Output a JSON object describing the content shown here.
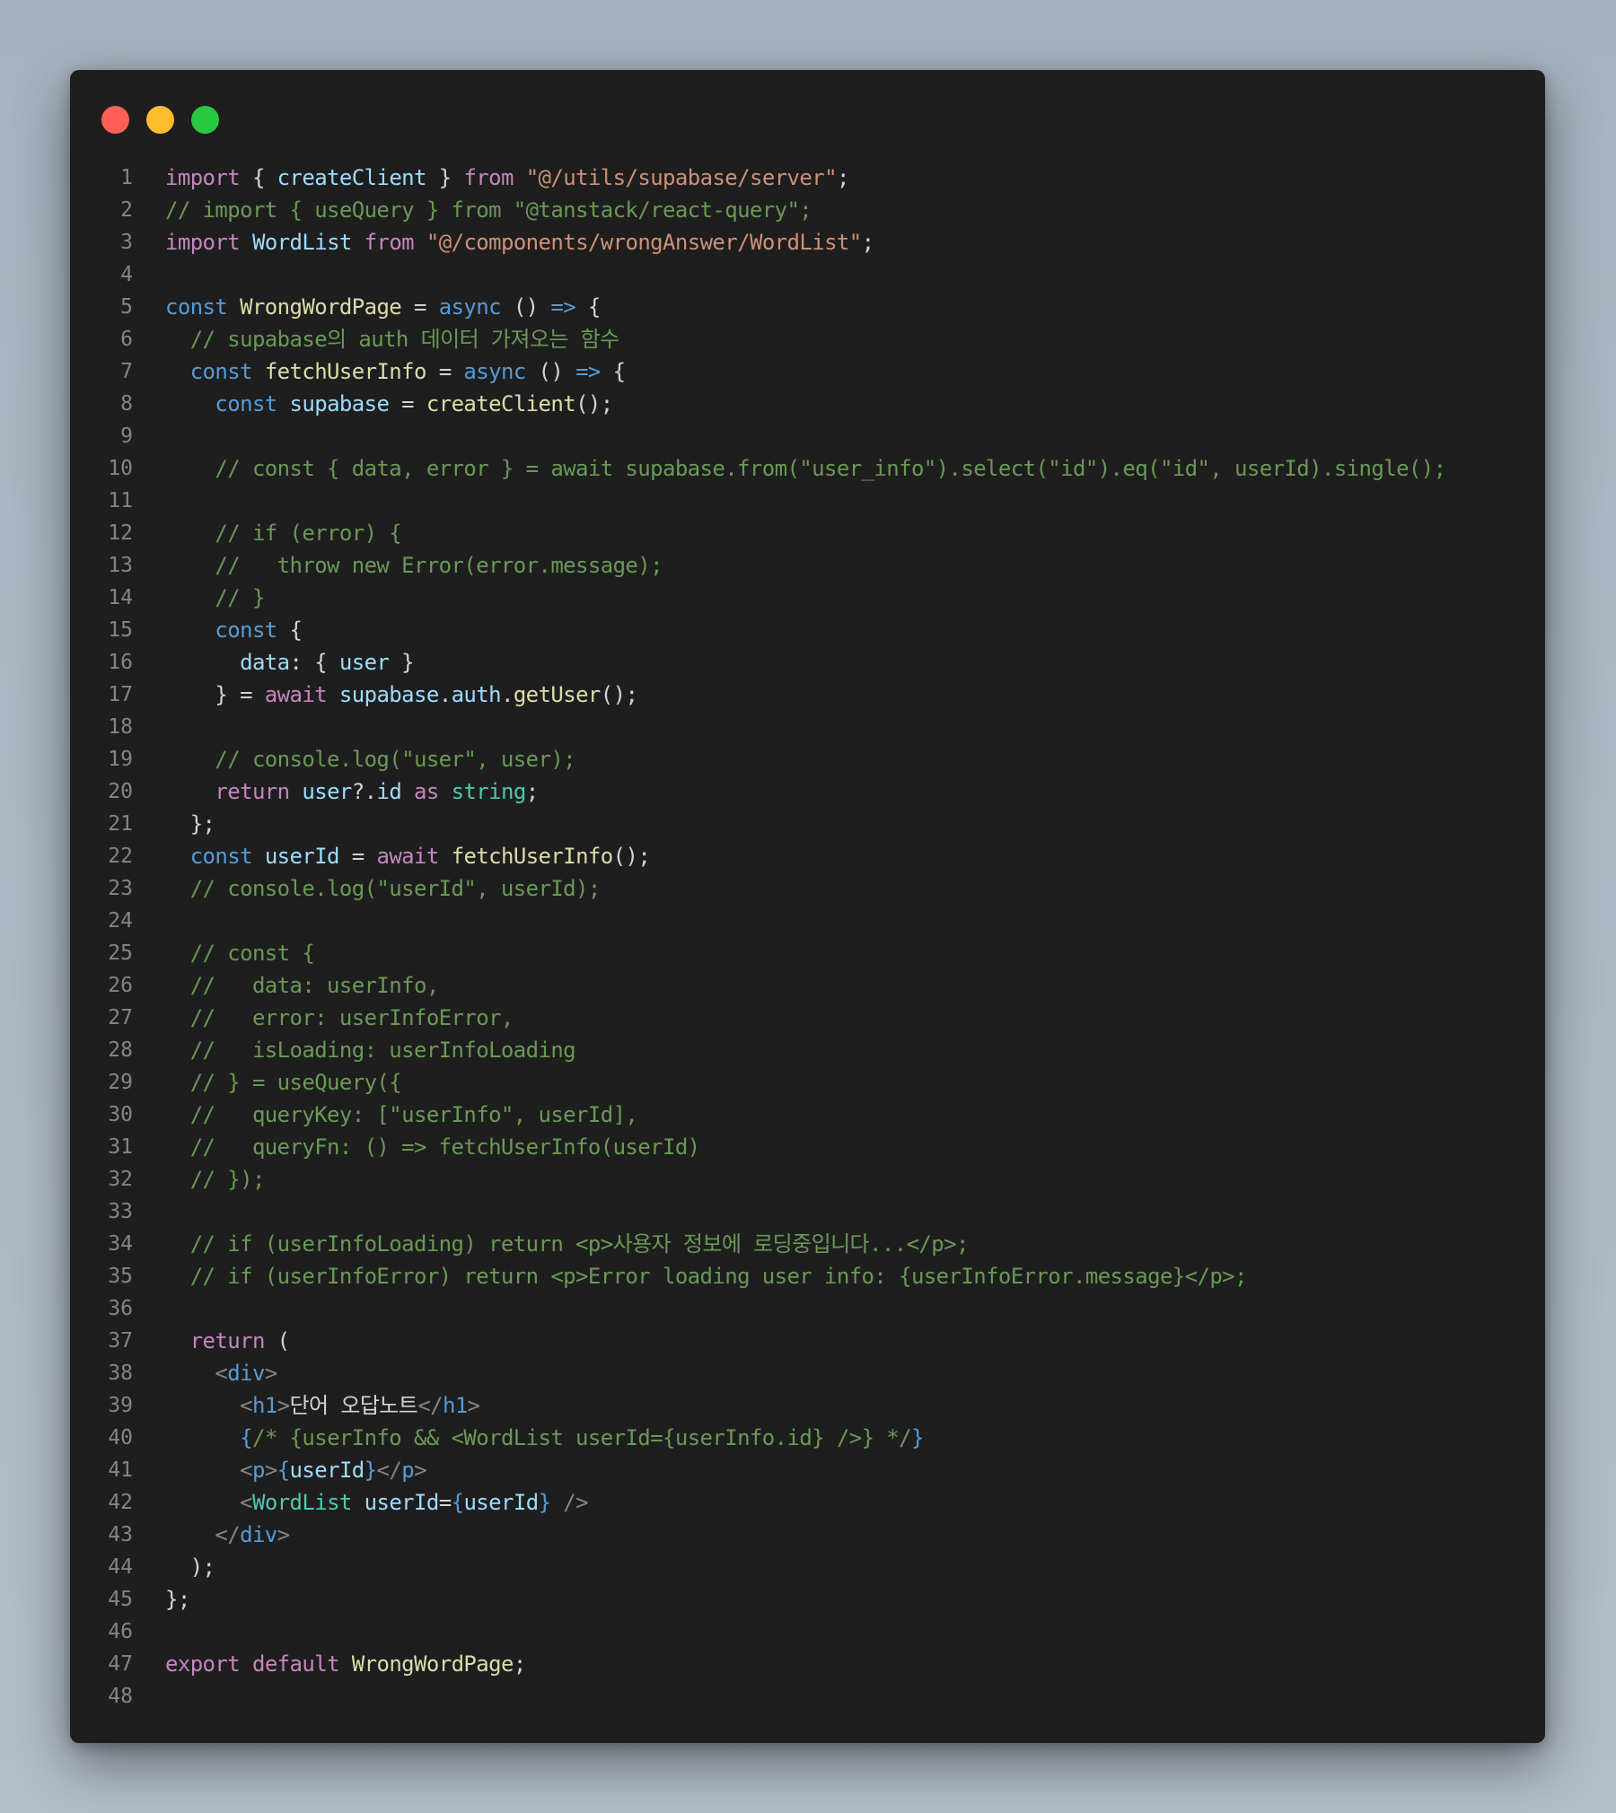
{
  "window": {
    "controls": [
      {
        "name": "close",
        "color": "#ff5f57"
      },
      {
        "name": "minimize",
        "color": "#febc2e"
      },
      {
        "name": "maximize",
        "color": "#28c840"
      }
    ]
  },
  "colors": {
    "background": "#1e1e1e",
    "line_number": "#858585",
    "keyword_purple": "#c586c0",
    "keyword_blue": "#569cd6",
    "string": "#ce9178",
    "comment": "#6a9955",
    "function": "#dcdcaa",
    "variable": "#9cdcfe",
    "type": "#4ec9b0",
    "default": "#d4d4d4"
  },
  "code": {
    "lines": [
      {
        "n": "1",
        "t": [
          [
            "import",
            "kw"
          ],
          [
            " { ",
            "pl"
          ],
          [
            "createClient",
            "vr"
          ],
          [
            " } ",
            "pl"
          ],
          [
            "from",
            "kw"
          ],
          [
            " ",
            "pl"
          ],
          [
            "\"@/utils/supabase/server\"",
            "st"
          ],
          [
            ";",
            "pl"
          ]
        ]
      },
      {
        "n": "2",
        "t": [
          [
            "// import { useQuery } from \"@tanstack/react-query\";",
            "cm"
          ]
        ]
      },
      {
        "n": "3",
        "t": [
          [
            "import",
            "kw"
          ],
          [
            " ",
            "pl"
          ],
          [
            "WordList",
            "vr"
          ],
          [
            " ",
            "pl"
          ],
          [
            "from",
            "kw"
          ],
          [
            " ",
            "pl"
          ],
          [
            "\"@/components/wrongAnswer/WordList\"",
            "st"
          ],
          [
            ";",
            "pl"
          ]
        ]
      },
      {
        "n": "4",
        "t": []
      },
      {
        "n": "5",
        "t": [
          [
            "const",
            "kb"
          ],
          [
            " ",
            "pl"
          ],
          [
            "WrongWordPage",
            "fn"
          ],
          [
            " = ",
            "pl"
          ],
          [
            "async",
            "kb"
          ],
          [
            " () ",
            "pl"
          ],
          [
            "=>",
            "kb"
          ],
          [
            " {",
            "pl"
          ]
        ]
      },
      {
        "n": "6",
        "t": [
          [
            "  // supabase의 auth 데이터 가져오는 함수",
            "cm"
          ]
        ]
      },
      {
        "n": "7",
        "t": [
          [
            "  ",
            "pl"
          ],
          [
            "const",
            "kb"
          ],
          [
            " ",
            "pl"
          ],
          [
            "fetchUserInfo",
            "fn"
          ],
          [
            " = ",
            "pl"
          ],
          [
            "async",
            "kb"
          ],
          [
            " () ",
            "pl"
          ],
          [
            "=>",
            "kb"
          ],
          [
            " {",
            "pl"
          ]
        ]
      },
      {
        "n": "8",
        "t": [
          [
            "    ",
            "pl"
          ],
          [
            "const",
            "kb"
          ],
          [
            " ",
            "pl"
          ],
          [
            "supabase",
            "vb"
          ],
          [
            " = ",
            "pl"
          ],
          [
            "createClient",
            "fn"
          ],
          [
            "();",
            "pl"
          ]
        ]
      },
      {
        "n": "9",
        "t": []
      },
      {
        "n": "10",
        "t": [
          [
            "    // const { data, error } = await supabase.from(\"user_info\").select(\"id\").eq(\"id\", userId).single();",
            "cm"
          ]
        ]
      },
      {
        "n": "11",
        "t": []
      },
      {
        "n": "12",
        "t": [
          [
            "    // if (error) {",
            "cm"
          ]
        ]
      },
      {
        "n": "13",
        "t": [
          [
            "    //   throw new Error(error.message);",
            "cm"
          ]
        ]
      },
      {
        "n": "14",
        "t": [
          [
            "    // }",
            "cm"
          ]
        ]
      },
      {
        "n": "15",
        "t": [
          [
            "    ",
            "pl"
          ],
          [
            "const",
            "kb"
          ],
          [
            " {",
            "pl"
          ]
        ]
      },
      {
        "n": "16",
        "t": [
          [
            "      ",
            "pl"
          ],
          [
            "data",
            "vr"
          ],
          [
            ": { ",
            "pl"
          ],
          [
            "user",
            "vb"
          ],
          [
            " }",
            "pl"
          ]
        ]
      },
      {
        "n": "17",
        "t": [
          [
            "    } = ",
            "pl"
          ],
          [
            "await",
            "kw"
          ],
          [
            " ",
            "pl"
          ],
          [
            "supabase",
            "vb"
          ],
          [
            ".",
            "pl"
          ],
          [
            "auth",
            "vr"
          ],
          [
            ".",
            "pl"
          ],
          [
            "getUser",
            "fn"
          ],
          [
            "();",
            "pl"
          ]
        ]
      },
      {
        "n": "18",
        "t": []
      },
      {
        "n": "19",
        "t": [
          [
            "    // console.log(\"user\", user);",
            "cm"
          ]
        ]
      },
      {
        "n": "20",
        "t": [
          [
            "    ",
            "pl"
          ],
          [
            "return",
            "kw"
          ],
          [
            " ",
            "pl"
          ],
          [
            "user",
            "vb"
          ],
          [
            "?.",
            "pl"
          ],
          [
            "id",
            "vr"
          ],
          [
            " ",
            "pl"
          ],
          [
            "as",
            "kw"
          ],
          [
            " ",
            "pl"
          ],
          [
            "string",
            "ty"
          ],
          [
            ";",
            "pl"
          ]
        ]
      },
      {
        "n": "21",
        "t": [
          [
            "  };",
            "pl"
          ]
        ]
      },
      {
        "n": "22",
        "t": [
          [
            "  ",
            "pl"
          ],
          [
            "const",
            "kb"
          ],
          [
            " ",
            "pl"
          ],
          [
            "userId",
            "vb"
          ],
          [
            " = ",
            "pl"
          ],
          [
            "await",
            "kw"
          ],
          [
            " ",
            "pl"
          ],
          [
            "fetchUserInfo",
            "fn"
          ],
          [
            "();",
            "pl"
          ]
        ]
      },
      {
        "n": "23",
        "t": [
          [
            "  // console.log(\"userId\", userId);",
            "cm"
          ]
        ]
      },
      {
        "n": "24",
        "t": []
      },
      {
        "n": "25",
        "t": [
          [
            "  // const {",
            "cm"
          ]
        ]
      },
      {
        "n": "26",
        "t": [
          [
            "  //   data: userInfo,",
            "cm"
          ]
        ]
      },
      {
        "n": "27",
        "t": [
          [
            "  //   error: userInfoError,",
            "cm"
          ]
        ]
      },
      {
        "n": "28",
        "t": [
          [
            "  //   isLoading: userInfoLoading",
            "cm"
          ]
        ]
      },
      {
        "n": "29",
        "t": [
          [
            "  // } = useQuery({",
            "cm"
          ]
        ]
      },
      {
        "n": "30",
        "t": [
          [
            "  //   queryKey: [\"userInfo\", userId],",
            "cm"
          ]
        ]
      },
      {
        "n": "31",
        "t": [
          [
            "  //   queryFn: () => fetchUserInfo(userId)",
            "cm"
          ]
        ]
      },
      {
        "n": "32",
        "t": [
          [
            "  // });",
            "cm"
          ]
        ]
      },
      {
        "n": "33",
        "t": []
      },
      {
        "n": "34",
        "t": [
          [
            "  // if (userInfoLoading) return <p>사용자 정보에 로딩중입니다...</p>;",
            "cm"
          ]
        ]
      },
      {
        "n": "35",
        "t": [
          [
            "  // if (userInfoError) return <p>Error loading user info: {userInfoError.message}</p>;",
            "cm"
          ]
        ]
      },
      {
        "n": "36",
        "t": []
      },
      {
        "n": "37",
        "t": [
          [
            "  ",
            "pl"
          ],
          [
            "return",
            "kw"
          ],
          [
            " (",
            "pl"
          ]
        ]
      },
      {
        "n": "38",
        "t": [
          [
            "    ",
            "pl"
          ],
          [
            "<",
            "tg"
          ],
          [
            "div",
            "kb"
          ],
          [
            ">",
            "tg"
          ]
        ]
      },
      {
        "n": "39",
        "t": [
          [
            "      ",
            "pl"
          ],
          [
            "<",
            "tg"
          ],
          [
            "h1",
            "kb"
          ],
          [
            ">",
            "tg"
          ],
          [
            "단어 오답노트",
            "pl"
          ],
          [
            "</",
            "tg"
          ],
          [
            "h1",
            "kb"
          ],
          [
            ">",
            "tg"
          ]
        ]
      },
      {
        "n": "40",
        "t": [
          [
            "      ",
            "pl"
          ],
          [
            "{",
            "kb"
          ],
          [
            "/* {userInfo && <WordList userId={userInfo.id} />} */",
            "cm"
          ],
          [
            "}",
            "kb"
          ]
        ]
      },
      {
        "n": "41",
        "t": [
          [
            "      ",
            "pl"
          ],
          [
            "<",
            "tg"
          ],
          [
            "p",
            "kb"
          ],
          [
            ">",
            "tg"
          ],
          [
            "{",
            "kb"
          ],
          [
            "userId",
            "vb"
          ],
          [
            "}",
            "kb"
          ],
          [
            "</",
            "tg"
          ],
          [
            "p",
            "kb"
          ],
          [
            ">",
            "tg"
          ]
        ]
      },
      {
        "n": "42",
        "t": [
          [
            "      ",
            "pl"
          ],
          [
            "<",
            "tg"
          ],
          [
            "WordList",
            "ty"
          ],
          [
            " ",
            "pl"
          ],
          [
            "userId",
            "vr"
          ],
          [
            "=",
            "pl"
          ],
          [
            "{",
            "kb"
          ],
          [
            "userId",
            "vb"
          ],
          [
            "}",
            "kb"
          ],
          [
            " ",
            "pl"
          ],
          [
            "/>",
            "tg"
          ]
        ]
      },
      {
        "n": "43",
        "t": [
          [
            "    ",
            "pl"
          ],
          [
            "</",
            "tg"
          ],
          [
            "div",
            "kb"
          ],
          [
            ">",
            "tg"
          ]
        ]
      },
      {
        "n": "44",
        "t": [
          [
            "  );",
            "pl"
          ]
        ]
      },
      {
        "n": "45",
        "t": [
          [
            "};",
            "pl"
          ]
        ]
      },
      {
        "n": "46",
        "t": []
      },
      {
        "n": "47",
        "t": [
          [
            "export",
            "kw"
          ],
          [
            " ",
            "pl"
          ],
          [
            "default",
            "kw"
          ],
          [
            " ",
            "pl"
          ],
          [
            "WrongWordPage",
            "fn"
          ],
          [
            ";",
            "pl"
          ]
        ]
      },
      {
        "n": "48",
        "t": []
      }
    ]
  }
}
